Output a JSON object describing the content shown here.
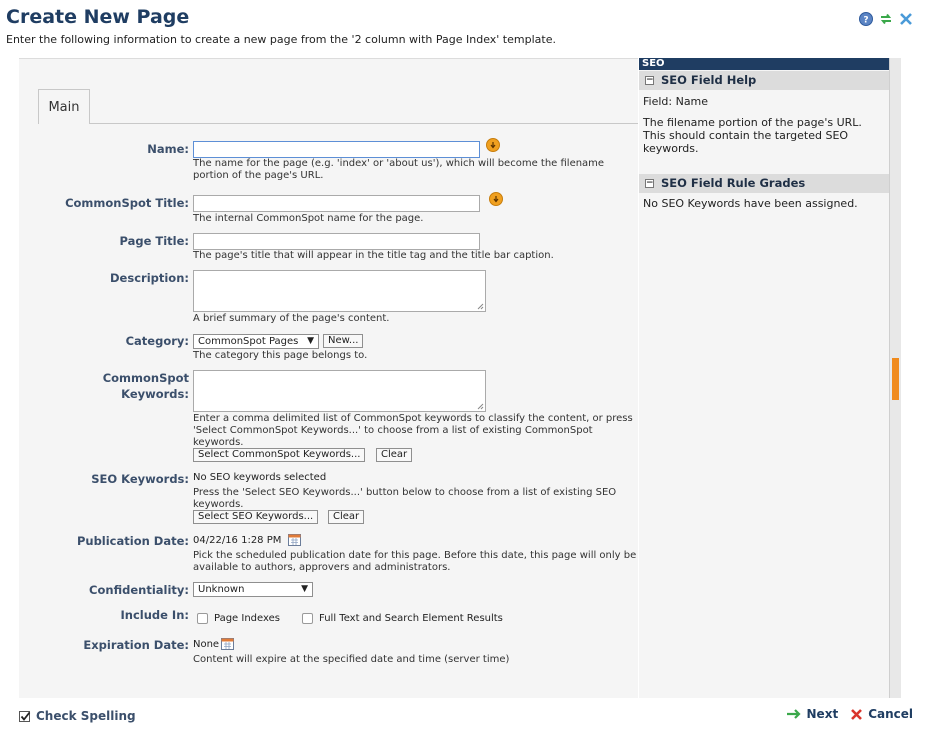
{
  "header": {
    "title": "Create New Page",
    "subtitle": "Enter the following information to create a new page from the '2 column with Page Index' template.",
    "icons": [
      "help-icon",
      "refresh-icon",
      "close-icon"
    ]
  },
  "tabs": [
    {
      "label": "Main"
    }
  ],
  "form": {
    "name": {
      "label": "Name:",
      "value": "",
      "hint": "The name for the page (e.g. 'index' or 'about us'), which will become the filename portion of the page's URL."
    },
    "cs_title": {
      "label": "CommonSpot Title:",
      "value": "",
      "hint": "The internal CommonSpot name for the page."
    },
    "page_title": {
      "label": "Page Title:",
      "value": "",
      "hint": "The page's title that will appear in the title tag and the title bar caption."
    },
    "description": {
      "label": "Description:",
      "value": "",
      "hint": "A brief summary of the page's content."
    },
    "category": {
      "label": "Category:",
      "selected": "CommonSpot Pages",
      "new_button": "New...",
      "hint": "The category this page belongs to."
    },
    "cs_keywords": {
      "label_line1": "CommonSpot",
      "label_line2": "Keywords:",
      "value": "",
      "hint": "Enter a comma delimited list of CommonSpot keywords to classify the content, or press 'Select CommonSpot Keywords...' to choose from a list of existing CommonSpot keywords.",
      "select_button": "Select CommonSpot Keywords...",
      "clear_button": "Clear"
    },
    "seo_keywords": {
      "label": "SEO Keywords:",
      "status": "No SEO keywords selected",
      "hint": "Press the 'Select SEO Keywords...' button below to choose from a list of existing SEO keywords.",
      "select_button": "Select SEO Keywords...",
      "clear_button": "Clear"
    },
    "publication_date": {
      "label": "Publication Date:",
      "value": "04/22/16 1:28 PM",
      "hint": "Pick the scheduled publication date for this page. Before this date, this page will only be available to authors, approvers and administrators."
    },
    "confidentiality": {
      "label": "Confidentiality:",
      "selected": "Unknown"
    },
    "include_in": {
      "label": "Include In:",
      "option1": "Page Indexes",
      "option2": "Full Text and Search Element Results"
    },
    "expiration_date": {
      "label": "Expiration Date:",
      "value": "None",
      "hint": "Content will expire at the specified date and time (server time)"
    }
  },
  "seo_panel": {
    "header": "SEO",
    "help_title": "SEO Field Help",
    "field_line": "Field: Name",
    "field_help": "The filename portion of the page's URL. This should contain the targeted SEO keywords.",
    "grades_title": "SEO Field Rule Grades",
    "grades_text": "No SEO Keywords have been assigned."
  },
  "footer": {
    "check_spelling": "Check Spelling",
    "next": "Next",
    "cancel": "Cancel"
  },
  "colors": {
    "title": "#1f3d62",
    "accent_orange": "#f0a020",
    "next_green": "#3aa84a",
    "cancel_red": "#d9342b"
  }
}
